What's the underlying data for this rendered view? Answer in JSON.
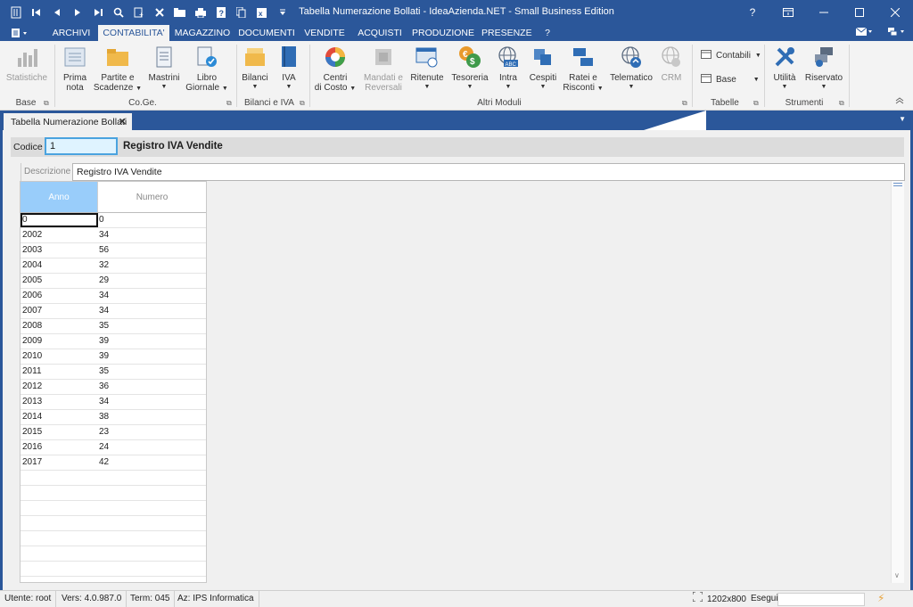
{
  "window": {
    "title": "Tabella Numerazione Bollati - IdeaAzienda.NET - Small Business Edition",
    "help": "?"
  },
  "menu": {
    "tabs": [
      "ARCHIVI",
      "CONTABILITA'",
      "MAGAZZINO",
      "DOCUMENTI",
      "VENDITE",
      "ACQUISTI",
      "PRODUZIONE",
      "PRESENZE",
      "?"
    ],
    "active": "CONTABILITA'"
  },
  "ribbon": {
    "statistiche": "Statistiche",
    "prima_nota": [
      "Prima",
      "nota"
    ],
    "partite": [
      "Partite e",
      "Scadenze"
    ],
    "mastrini": "Mastrini",
    "libro": [
      "Libro",
      "Giornale"
    ],
    "bilanci": "Bilanci",
    "iva": "IVA",
    "centri": [
      "Centri",
      "di Costo"
    ],
    "mandati": [
      "Mandati e",
      "Reversali"
    ],
    "ritenute": "Ritenute",
    "tesoreria": "Tesoreria",
    "intra": "Intra",
    "cespiti": "Cespiti",
    "ratei": [
      "Ratei e",
      "Risconti"
    ],
    "telematico": "Telematico",
    "crm": "CRM",
    "contabili": "Contabili",
    "base_btn": "Base",
    "utilita": "Utilità",
    "riservato": "Riservato",
    "groups": {
      "base": "Base",
      "coge": "Co.Ge.",
      "bilanci_iva": "Bilanci e IVA",
      "altri": "Altri Moduli",
      "tabelle": "Tabelle",
      "strumenti": "Strumenti"
    }
  },
  "doc_tab": {
    "label": "Tabella Numerazione Bollati",
    "close": "✕"
  },
  "form": {
    "codice_label": "Codice",
    "codice_value": "1",
    "codice_desc": "Registro IVA Vendite",
    "descrizione_label": "Descrizione",
    "descrizione_value": "Registro IVA Vendite"
  },
  "grid": {
    "columns": [
      "Anno",
      "Numero"
    ],
    "rows": [
      [
        "0",
        "0"
      ],
      [
        "2002",
        "34"
      ],
      [
        "2003",
        "56"
      ],
      [
        "2004",
        "32"
      ],
      [
        "2005",
        "29"
      ],
      [
        "2006",
        "34"
      ],
      [
        "2007",
        "34"
      ],
      [
        "2008",
        "35"
      ],
      [
        "2009",
        "39"
      ],
      [
        "2010",
        "39"
      ],
      [
        "2011",
        "35"
      ],
      [
        "2012",
        "36"
      ],
      [
        "2013",
        "34"
      ],
      [
        "2014",
        "38"
      ],
      [
        "2015",
        "23"
      ],
      [
        "2016",
        "24"
      ],
      [
        "2017",
        "42"
      ],
      [
        "",
        ""
      ],
      [
        "",
        ""
      ],
      [
        "",
        ""
      ],
      [
        "",
        ""
      ],
      [
        "",
        ""
      ],
      [
        "",
        ""
      ],
      [
        "",
        ""
      ]
    ]
  },
  "status": {
    "utente": "Utente: root",
    "versione": "Vers: 4.0.987.0",
    "terminale": "Term: 045",
    "azienda": "Az: IPS Informatica",
    "risoluzione": "1202x800",
    "esegui": "Esegui"
  },
  "colors": {
    "accent": "#2b579a",
    "header_selected": "#99cdfa",
    "input_focus": "#4aa3df"
  }
}
